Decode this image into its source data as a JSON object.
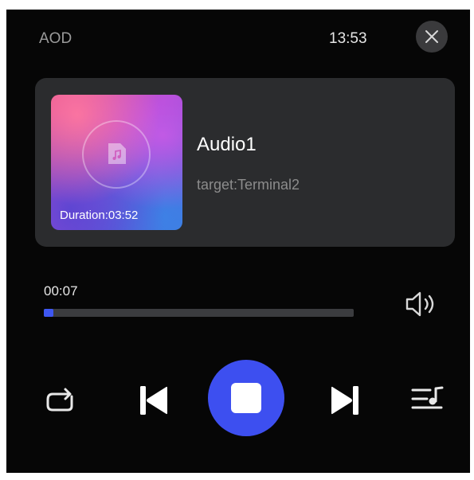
{
  "header": {
    "app_label": "AOD",
    "time": "13:53",
    "close_icon": "close-icon"
  },
  "track": {
    "title": "Audio1",
    "target": "target:Terminal2",
    "duration_label": "Duration:03:52",
    "cover_icon": "music-file-icon"
  },
  "playback": {
    "elapsed": "00:07",
    "progress_percent": 3,
    "volume_icon": "volume-icon"
  },
  "controls": {
    "repeat_icon": "repeat-icon",
    "previous_icon": "skip-previous-icon",
    "stop_icon": "stop-icon",
    "next_icon": "skip-next-icon",
    "playlist_icon": "playlist-icon"
  },
  "colors": {
    "accent": "#3d4ff0",
    "background": "#060606",
    "card": "#2b2c2e"
  }
}
